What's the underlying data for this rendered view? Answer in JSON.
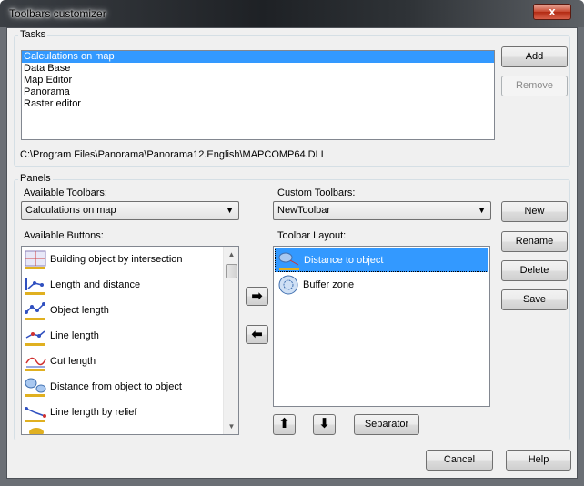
{
  "window": {
    "title": "Toolbars customizer",
    "close_label": "x"
  },
  "tasks": {
    "group_label": "Tasks",
    "items": [
      "Calculations on map",
      "Data Base",
      "Map Editor",
      "Panorama",
      "Raster editor"
    ],
    "selected_index": 0,
    "add_label": "Add",
    "remove_label": "Remove",
    "path": "C:\\Program Files\\Panorama\\Panorama12.English\\MAPCOMP64.DLL"
  },
  "panels": {
    "group_label": "Panels",
    "available_toolbars_label": "Available Toolbars:",
    "available_toolbars_value": "Calculations on map",
    "custom_toolbars_label": "Custom Toolbars:",
    "custom_toolbars_value": "NewToolbar",
    "available_buttons_label": "Available Buttons:",
    "available_buttons": [
      "Building object by intersection",
      "Length and distance",
      "Object length",
      "Line length",
      "Cut length",
      "Distance from object to object",
      "Line length by relief"
    ],
    "toolbar_layout_label": "Toolbar  Layout:",
    "toolbar_layout": [
      "Distance to object",
      "Buffer zone"
    ],
    "layout_selected_index": 0,
    "new_label": "New",
    "rename_label": "Rename",
    "delete_label": "Delete",
    "save_label": "Save",
    "separator_label": "Separator"
  },
  "footer": {
    "cancel_label": "Cancel",
    "help_label": "Help"
  },
  "colors": {
    "selection": "#3399ff",
    "titlebar": "#1e2125",
    "client": "#f0f0f0"
  }
}
